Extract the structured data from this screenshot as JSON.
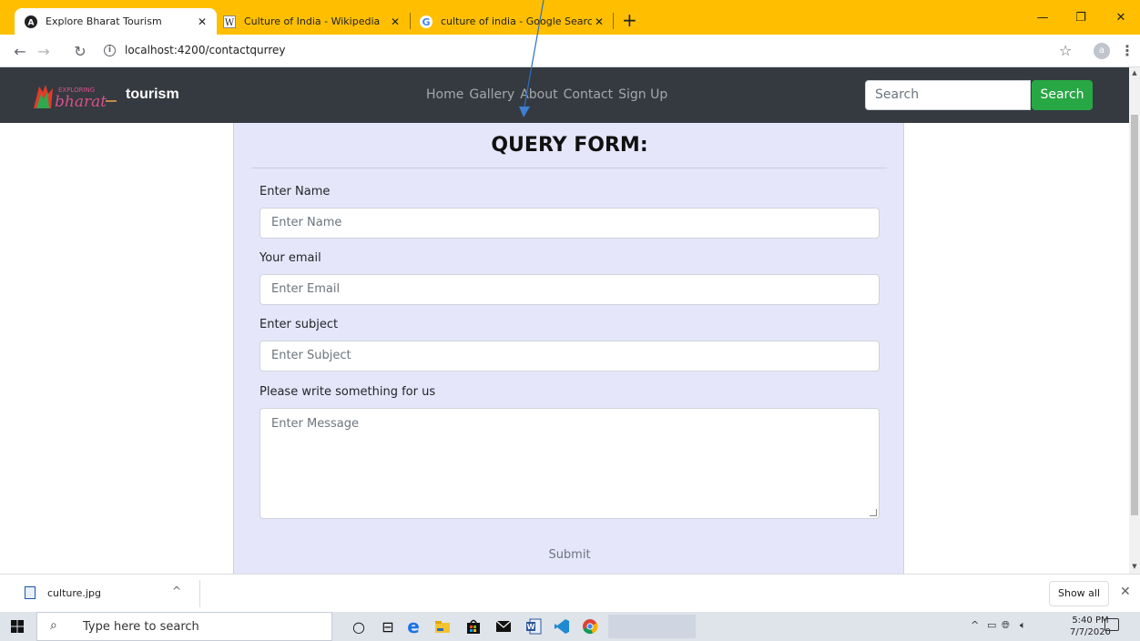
{
  "browser": {
    "tabs": [
      {
        "title": "Explore Bharat Tourism",
        "icon": "angular-icon",
        "active": true
      },
      {
        "title": "Culture of India - Wikipedia",
        "icon": "wikipedia-icon",
        "active": false
      },
      {
        "title": "culture of india - Google Search",
        "icon": "google-icon",
        "active": false
      }
    ],
    "new_tab": "+",
    "url": "localhost:4200/contactqurrey",
    "profile_initial": "a",
    "accent_color": "#ffbf00"
  },
  "site": {
    "logo_text_top": "EXPLORING",
    "logo_text_main": "bharat",
    "brand": "tourism",
    "nav": [
      "Home",
      "Gallery",
      "About",
      "Contact",
      "Sign Up"
    ],
    "search_placeholder": "Search",
    "search_button": "Search",
    "navbar_color": "#343a40",
    "search_button_color": "#28a745"
  },
  "form": {
    "title": "QUERY FORM:",
    "name_label": "Enter Name",
    "name_placeholder": "Enter Name",
    "email_label": "Your email",
    "email_placeholder": "Enter Email",
    "subject_label": "Enter subject",
    "subject_placeholder": "Enter Subject",
    "message_label": "Please write something for us",
    "message_placeholder": "Enter Message",
    "submit": "Submit",
    "panel_color": "#e6e6fa"
  },
  "downloads": {
    "file_name": "culture.jpg",
    "show_all": "Show all"
  },
  "taskbar": {
    "search_placeholder": "Type here to search",
    "time": "5:40 PM",
    "date": "7/7/2020"
  }
}
